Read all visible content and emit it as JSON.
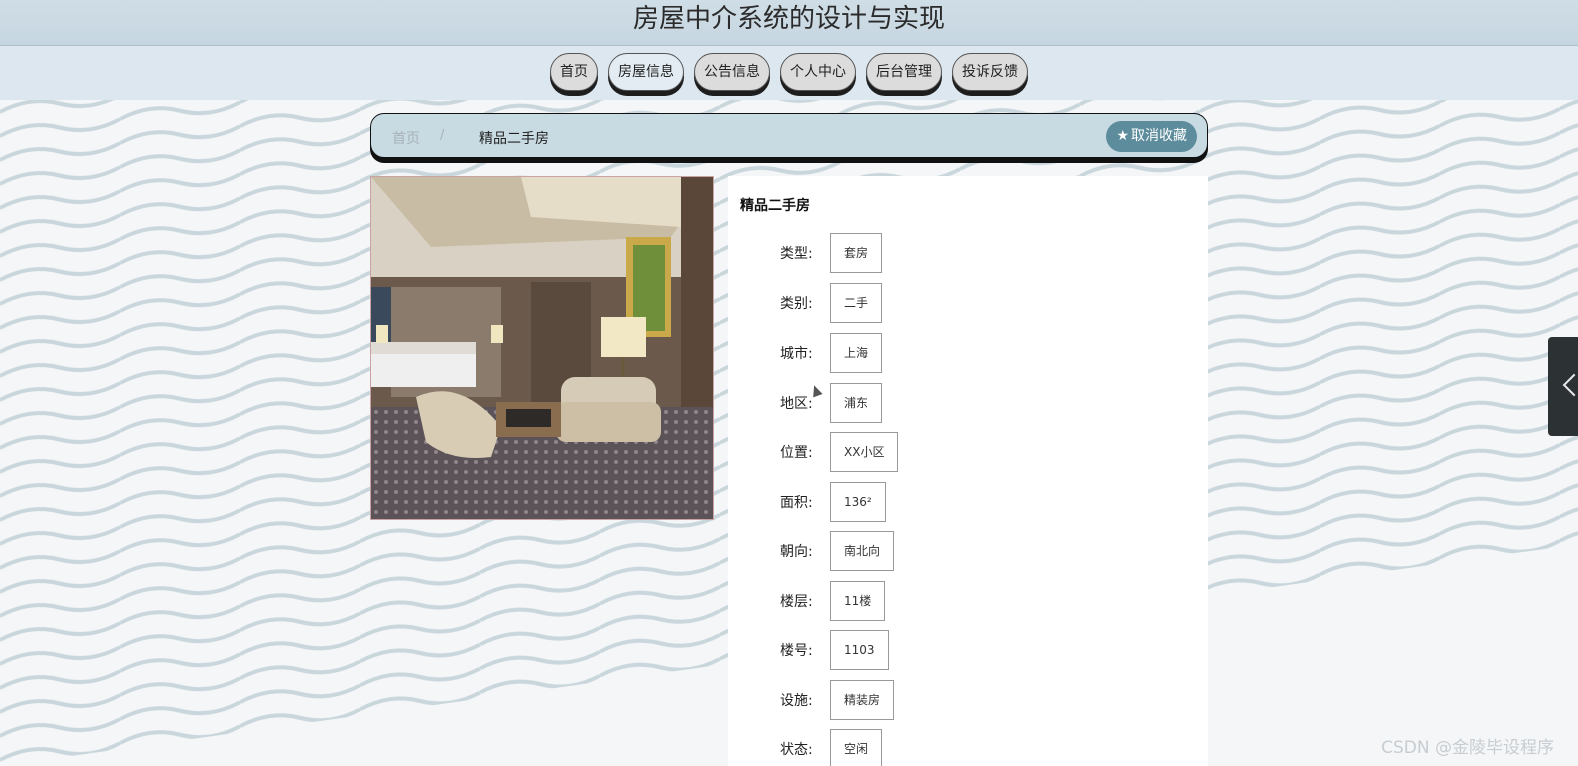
{
  "site": {
    "title": "房屋中介系统的设计与实现"
  },
  "nav": {
    "items": [
      {
        "label": "首页"
      },
      {
        "label": "房屋信息"
      },
      {
        "label": "公告信息"
      },
      {
        "label": "个人中心"
      },
      {
        "label": "后台管理"
      },
      {
        "label": "投诉反馈"
      }
    ]
  },
  "breadcrumb": {
    "home": "首页",
    "separator": "/",
    "current": "精品二手房",
    "favorite_label": "取消收藏",
    "favorite_icon": "star-icon"
  },
  "house": {
    "title": "精品二手房",
    "fields": [
      {
        "label": "类型:",
        "value": "套房"
      },
      {
        "label": "类别:",
        "value": "二手"
      },
      {
        "label": "城市:",
        "value": "上海"
      },
      {
        "label": "地区:",
        "value": "浦东"
      },
      {
        "label": "位置:",
        "value": "XX小区"
      },
      {
        "label": "面积:",
        "value": "136²"
      },
      {
        "label": "朝向:",
        "value": "南北向"
      },
      {
        "label": "楼层:",
        "value": "11楼"
      },
      {
        "label": "楼号:",
        "value": "1103"
      },
      {
        "label": "设施:",
        "value": "精装房"
      },
      {
        "label": "状态:",
        "value": "空闲"
      }
    ]
  },
  "watermark": "CSDN @金陵毕设程序",
  "colors": {
    "accent": "#5d8c9c",
    "header_bg": "#cfdde6",
    "nav_bg": "#dce7ef",
    "breadcrumb_bg": "#c8dae2"
  }
}
